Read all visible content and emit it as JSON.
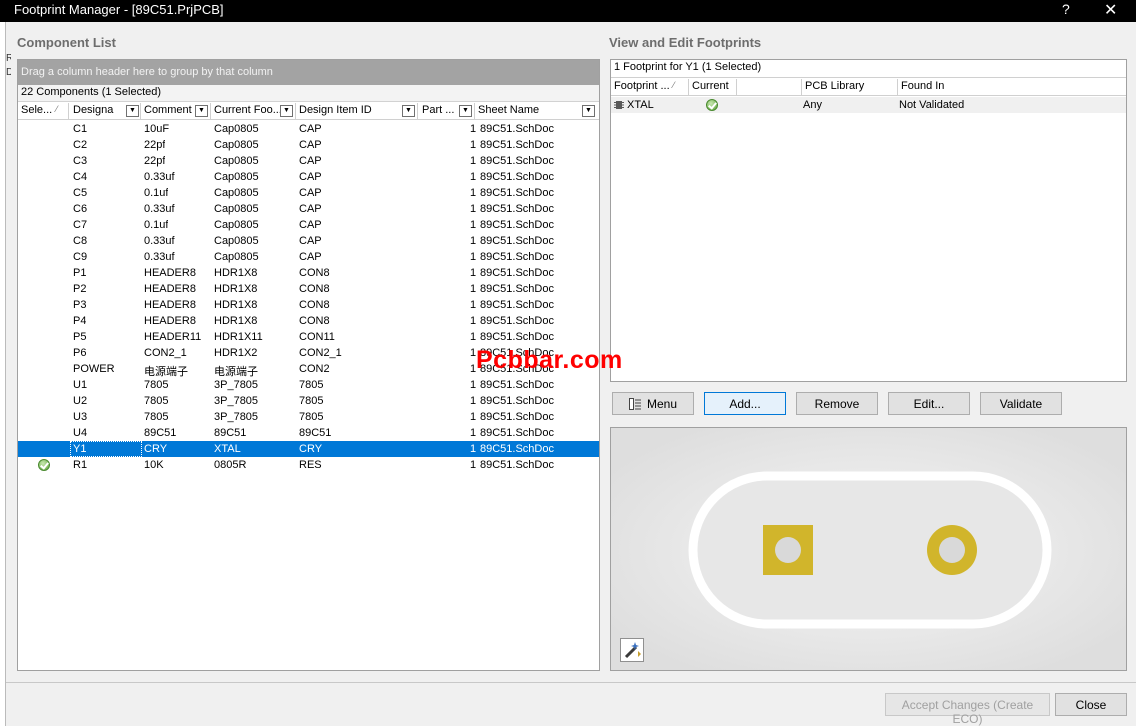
{
  "window": {
    "title": "Footprint Manager - [89C51.PrjPCB]",
    "help_label": "?",
    "close_label": "✕"
  },
  "edge_fragment": "R\nD",
  "component_list": {
    "title": "Component List",
    "group_hint": "Drag a column header here to group by that column",
    "count": "22 Components (1 Selected)",
    "columns": [
      "Sele...",
      "Designa",
      "Comment",
      "Current Foo...",
      "Design Item ID",
      "Part ...",
      "Sheet Name"
    ],
    "rows": [
      {
        "designator": "C1",
        "comment": "10uF",
        "footprint": "Cap0805",
        "design_item_id": "CAP",
        "part": "1",
        "sheet": "89C51.SchDoc"
      },
      {
        "designator": "C2",
        "comment": "22pf",
        "footprint": "Cap0805",
        "design_item_id": "CAP",
        "part": "1",
        "sheet": "89C51.SchDoc"
      },
      {
        "designator": "C3",
        "comment": "22pf",
        "footprint": "Cap0805",
        "design_item_id": "CAP",
        "part": "1",
        "sheet": "89C51.SchDoc"
      },
      {
        "designator": "C4",
        "comment": "0.33uf",
        "footprint": "Cap0805",
        "design_item_id": "CAP",
        "part": "1",
        "sheet": "89C51.SchDoc"
      },
      {
        "designator": "C5",
        "comment": "0.1uf",
        "footprint": "Cap0805",
        "design_item_id": "CAP",
        "part": "1",
        "sheet": "89C51.SchDoc"
      },
      {
        "designator": "C6",
        "comment": "0.33uf",
        "footprint": "Cap0805",
        "design_item_id": "CAP",
        "part": "1",
        "sheet": "89C51.SchDoc"
      },
      {
        "designator": "C7",
        "comment": "0.1uf",
        "footprint": "Cap0805",
        "design_item_id": "CAP",
        "part": "1",
        "sheet": "89C51.SchDoc"
      },
      {
        "designator": "C8",
        "comment": "0.33uf",
        "footprint": "Cap0805",
        "design_item_id": "CAP",
        "part": "1",
        "sheet": "89C51.SchDoc"
      },
      {
        "designator": "C9",
        "comment": "0.33uf",
        "footprint": "Cap0805",
        "design_item_id": "CAP",
        "part": "1",
        "sheet": "89C51.SchDoc"
      },
      {
        "designator": "P1",
        "comment": "HEADER8",
        "footprint": "HDR1X8",
        "design_item_id": "CON8",
        "part": "1",
        "sheet": "89C51.SchDoc"
      },
      {
        "designator": "P2",
        "comment": "HEADER8",
        "footprint": "HDR1X8",
        "design_item_id": "CON8",
        "part": "1",
        "sheet": "89C51.SchDoc"
      },
      {
        "designator": "P3",
        "comment": "HEADER8",
        "footprint": "HDR1X8",
        "design_item_id": "CON8",
        "part": "1",
        "sheet": "89C51.SchDoc"
      },
      {
        "designator": "P4",
        "comment": "HEADER8",
        "footprint": "HDR1X8",
        "design_item_id": "CON8",
        "part": "1",
        "sheet": "89C51.SchDoc"
      },
      {
        "designator": "P5",
        "comment": "HEADER11",
        "footprint": "HDR1X11",
        "design_item_id": "CON11",
        "part": "1",
        "sheet": "89C51.SchDoc"
      },
      {
        "designator": "P6",
        "comment": "CON2_1",
        "footprint": "HDR1X2",
        "design_item_id": "CON2_1",
        "part": "1",
        "sheet": "89C51.SchDoc"
      },
      {
        "designator": "POWER",
        "comment": "电源端子",
        "footprint": "电源端子",
        "design_item_id": "CON2",
        "part": "1",
        "sheet": "89C51.SchDoc"
      },
      {
        "designator": "U1",
        "comment": "7805",
        "footprint": "3P_7805",
        "design_item_id": "7805",
        "part": "1",
        "sheet": "89C51.SchDoc"
      },
      {
        "designator": "U2",
        "comment": "7805",
        "footprint": "3P_7805",
        "design_item_id": "7805",
        "part": "1",
        "sheet": "89C51.SchDoc"
      },
      {
        "designator": "U3",
        "comment": "7805",
        "footprint": "3P_7805",
        "design_item_id": "7805",
        "part": "1",
        "sheet": "89C51.SchDoc"
      },
      {
        "designator": "U4",
        "comment": "89C51",
        "footprint": "89C51",
        "design_item_id": "89C51",
        "part": "1",
        "sheet": "89C51.SchDoc"
      },
      {
        "designator": "Y1",
        "comment": "CRY",
        "footprint": "XTAL",
        "design_item_id": "CRY",
        "part": "1",
        "sheet": "89C51.SchDoc",
        "selected": true
      },
      {
        "designator": "R1",
        "comment": "10K",
        "footprint": "0805R",
        "design_item_id": "RES",
        "part": "1",
        "sheet": "89C51.SchDoc",
        "checked": true
      }
    ]
  },
  "footprints": {
    "title": "View and Edit Footprints",
    "count": "1 Footprint for Y1 (1 Selected)",
    "columns": [
      "Footprint ...",
      "Current",
      "",
      "PCB Library",
      "Found In"
    ],
    "rows": [
      {
        "footprint": "XTAL",
        "current": true,
        "pcb_library": "Any",
        "found_in": "Not Validated"
      }
    ]
  },
  "buttons": {
    "menu": "Menu",
    "add": "Add...",
    "remove": "Remove",
    "edit": "Edit...",
    "validate": "Validate",
    "accept": "Accept Changes (Create ECO)",
    "close": "Close"
  },
  "watermark": "Pcbbar.com",
  "icons": {
    "menu": "menu-list-icon",
    "preview_tool": "magic-wand-icon",
    "footprint_chip": "chip-icon",
    "check": "check-circle-icon",
    "dropdown": "chevron-down-icon"
  },
  "colors": {
    "selection": "#0078d7",
    "pad": "#d1b52b",
    "watermark": "#ff0000"
  }
}
